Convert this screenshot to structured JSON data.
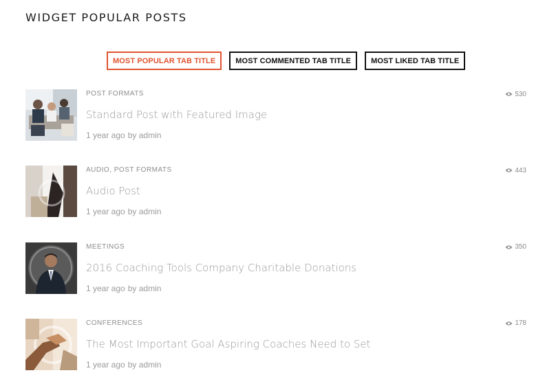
{
  "widget": {
    "title": "WIDGET POPULAR POSTS"
  },
  "tabs": [
    {
      "label": "MOST POPULAR TAB TITLE",
      "active": true
    },
    {
      "label": "MOST COMMENTED TAB TITLE",
      "active": false
    },
    {
      "label": "MOST LIKED TAB TITLE",
      "active": false
    }
  ],
  "colors": {
    "accent": "#e0532f",
    "muted_text": "#9a9a9a",
    "tab_border": "#111111"
  },
  "posts": [
    {
      "categories": [
        "POST FORMATS"
      ],
      "title": "Standard Post with Featured Image",
      "date": "1 year ago",
      "author": "by admin",
      "views": "530",
      "thumb": "meeting-photo"
    },
    {
      "categories": [
        "AUDIO, ",
        "POST FORMATS"
      ],
      "title": "Audio Post",
      "date": "1 year ago",
      "author": "by admin",
      "views": "443",
      "thumb": "businessman-photo"
    },
    {
      "categories": [
        "MEETINGS"
      ],
      "title": "2016 Coaching Tools Company Charitable Donations",
      "date": "1 year ago",
      "author": "by admin",
      "views": "350",
      "thumb": "portrait-photo"
    },
    {
      "categories": [
        "CONFERENCES"
      ],
      "title": "The Most Important Goal Aspiring Coaches Need to Set",
      "date": "1 year ago",
      "author": "by admin",
      "views": "178",
      "thumb": "handshake-photo"
    }
  ],
  "icons": {
    "views": "eye-icon"
  }
}
